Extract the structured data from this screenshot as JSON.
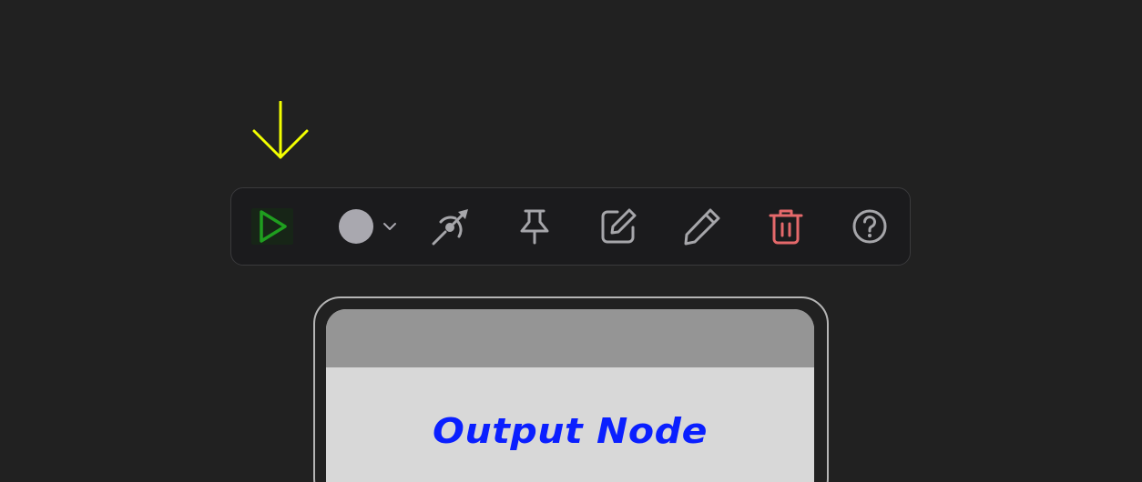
{
  "toolbar": {
    "buttons": [
      {
        "name": "run",
        "icon": "play-icon",
        "color": "#1f9e1f"
      },
      {
        "name": "color",
        "icon": "color-circle-icon",
        "swatch_color": "#a9a8af"
      },
      {
        "name": "connect",
        "icon": "connect-arrow-icon"
      },
      {
        "name": "pin",
        "icon": "pin-icon"
      },
      {
        "name": "edit",
        "icon": "edit-square-icon"
      },
      {
        "name": "rename",
        "icon": "pencil-icon"
      },
      {
        "name": "delete",
        "icon": "trash-icon",
        "color": "#e5696b"
      },
      {
        "name": "help",
        "icon": "help-circle-icon"
      }
    ]
  },
  "indicator": {
    "icon": "arrow-down-icon",
    "color": "#f2ff00"
  },
  "node": {
    "title": "Output Node",
    "title_color": "#0a1fff"
  }
}
